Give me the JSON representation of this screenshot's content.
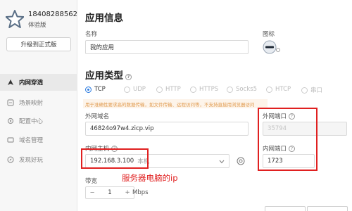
{
  "sidebar": {
    "username": "18408288562",
    "version": "体验版",
    "upgrade_label": "升级到正式版",
    "items": [
      {
        "label": "内网穿透",
        "icon": "tunnel-icon",
        "active": true
      },
      {
        "label": "场景映射",
        "icon": "scene-icon",
        "active": false
      },
      {
        "label": "配置中心",
        "icon": "settings-icon",
        "active": false
      },
      {
        "label": "域名管理",
        "icon": "domain-icon",
        "active": false
      },
      {
        "label": "发现好玩",
        "icon": "discover-icon",
        "active": false
      }
    ]
  },
  "main": {
    "app_info": {
      "title": "应用信息",
      "name_label": "名称",
      "name_value": "我的应用",
      "icon_label": "图标"
    },
    "app_type": {
      "title": "应用类型",
      "options": [
        "TCP",
        "UDP",
        "HTTP",
        "HTTPS",
        "Socks5",
        "HTCP",
        "串口"
      ],
      "selected": "TCP",
      "notice": "用于准确性要求高的数据传输，如文件传输、远程访问等，不支持直接用浏览器访问"
    },
    "external_domain": {
      "label": "外网域名",
      "value": "46824o97w4.zicp.vip"
    },
    "external_port": {
      "label": "外网端口",
      "value": "35794"
    },
    "internal_host": {
      "label": "内网主机",
      "value": "192.168.3.100",
      "suffix": "本机"
    },
    "internal_port": {
      "label": "内网端口",
      "value": "1723"
    },
    "annotation": "服务器电脑的ip",
    "bandwidth": {
      "label": "带宽",
      "value": "1",
      "unit": "Mbps"
    }
  },
  "colors": {
    "accent": "#2f7de1",
    "annotation": "#e02020",
    "notice_text": "#e09a4e"
  }
}
